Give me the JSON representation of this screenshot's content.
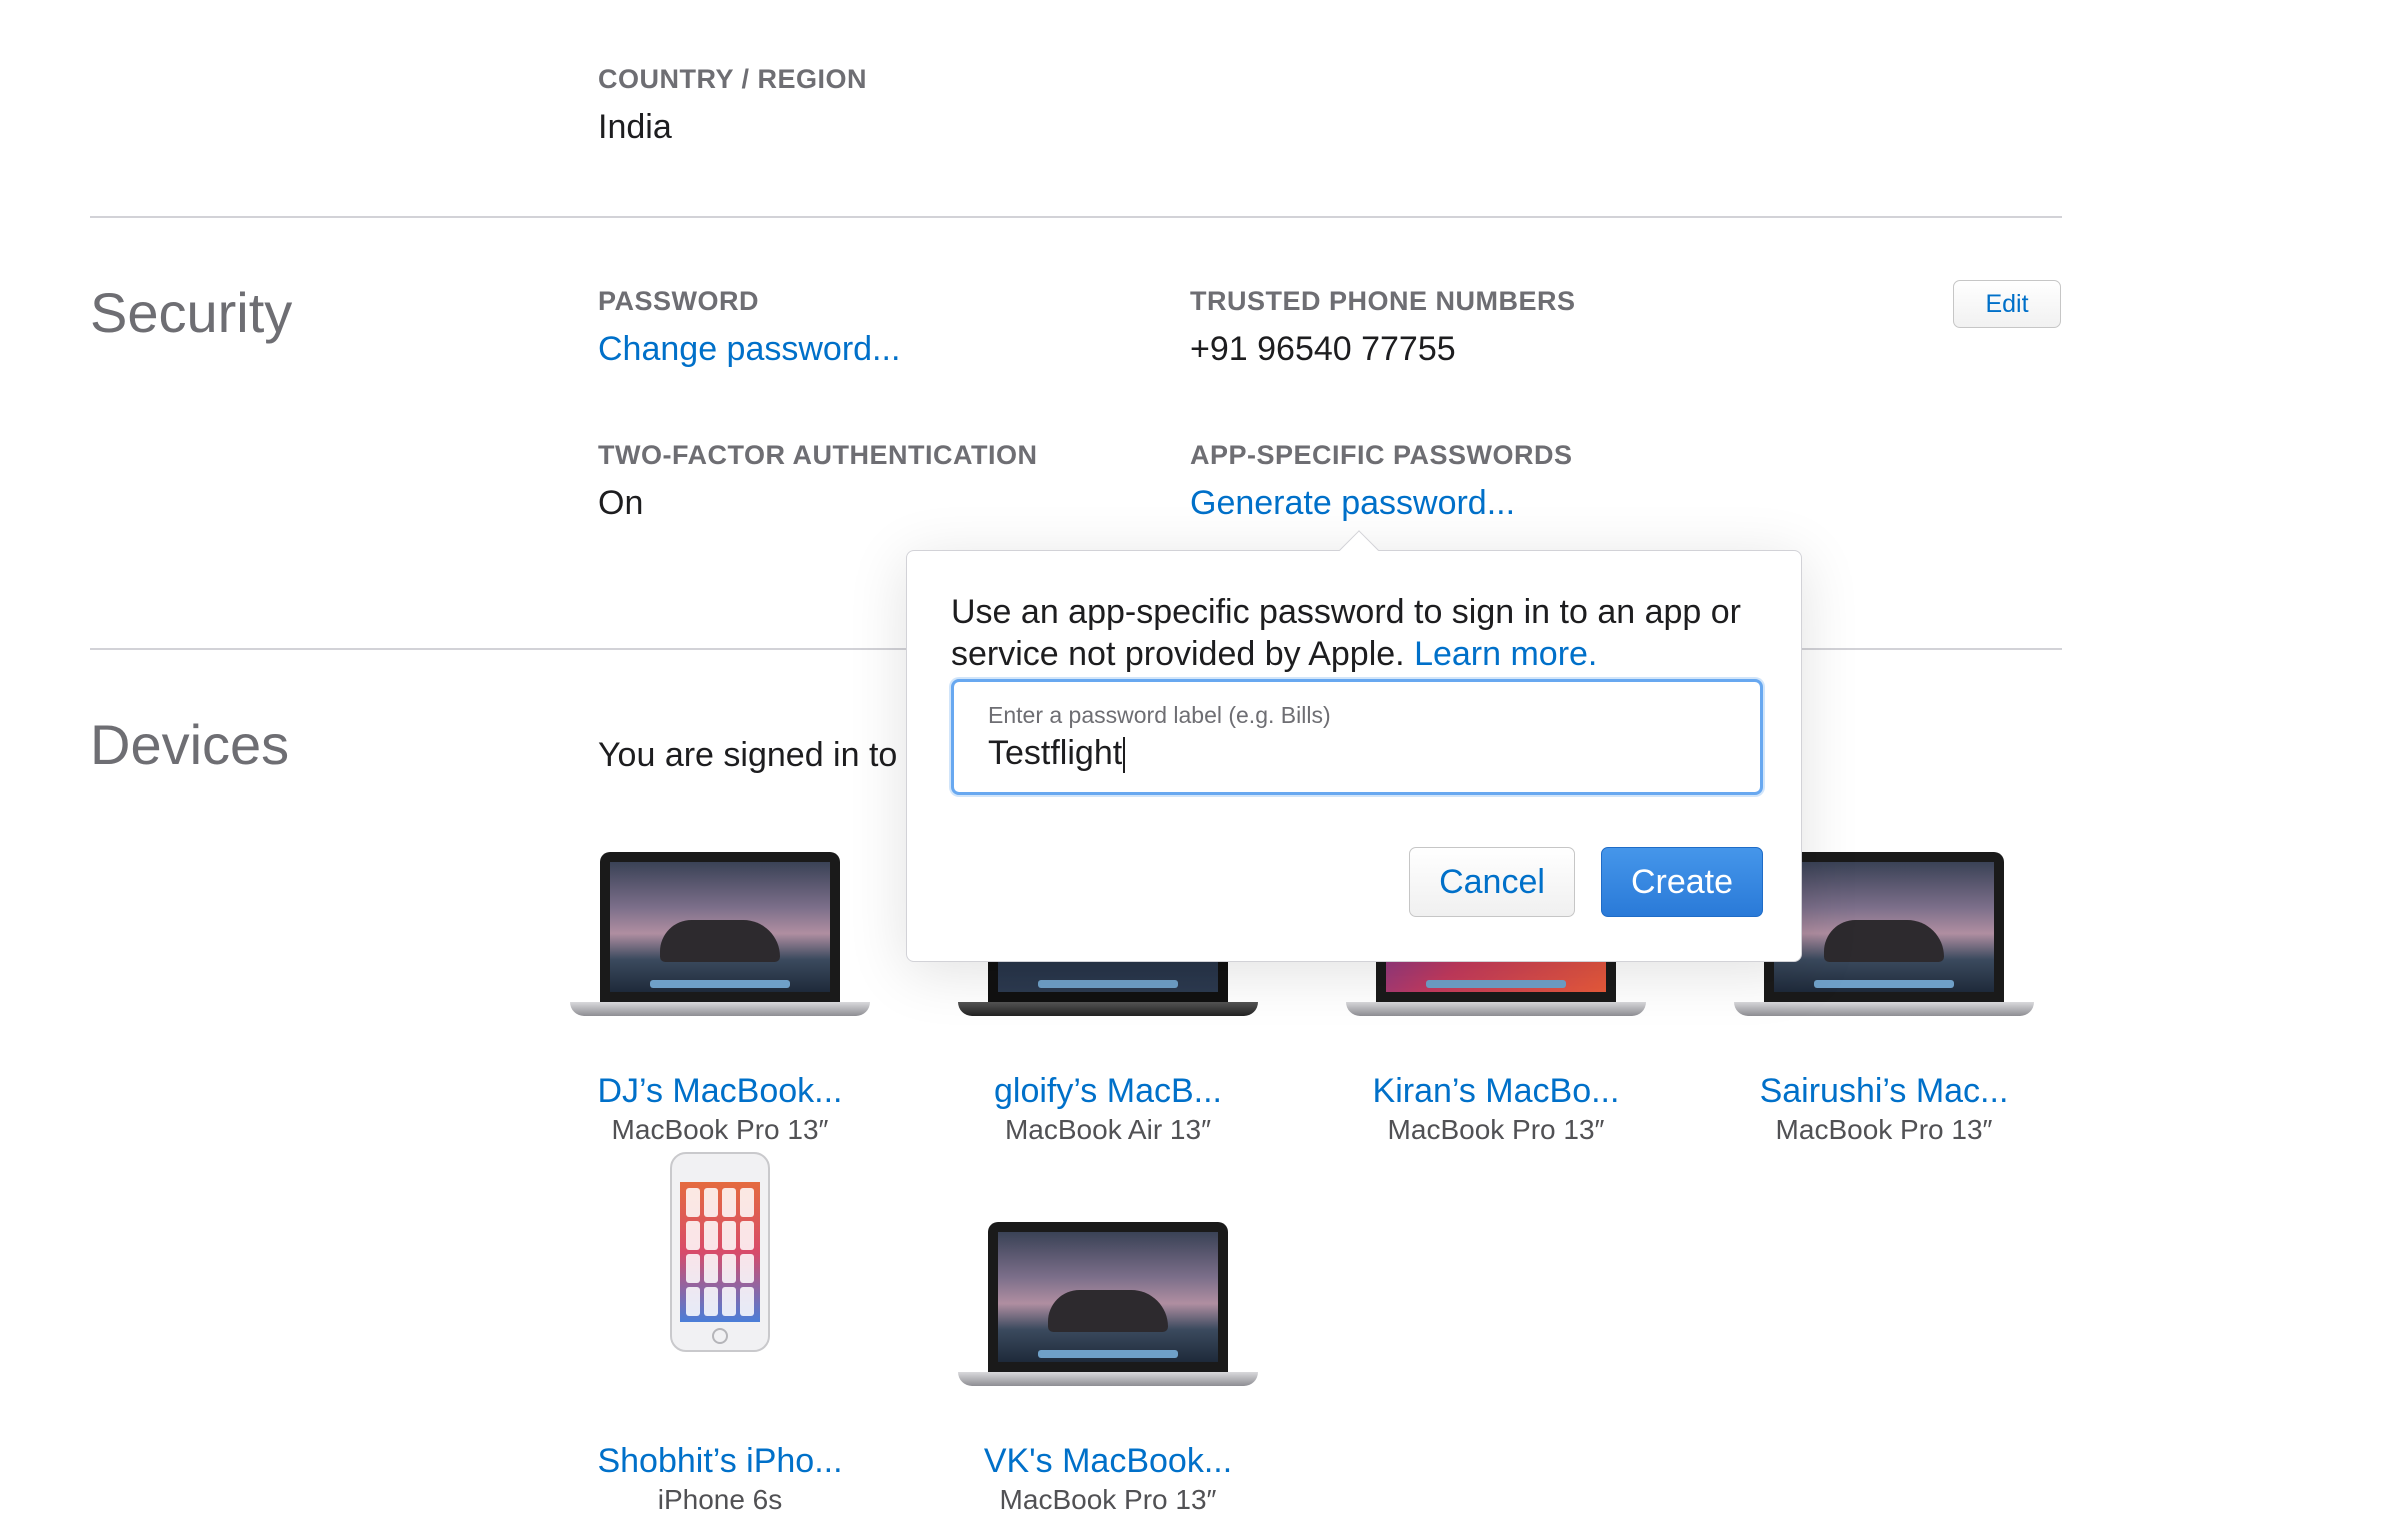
{
  "country": {
    "label": "COUNTRY / REGION",
    "value": "India"
  },
  "security": {
    "title": "Security",
    "password_label": "PASSWORD",
    "change_password_link": "Change password...",
    "trusted_label": "TRUSTED PHONE NUMBERS",
    "trusted_value": "+91 96540 77755",
    "edit_button": "Edit",
    "two_factor_label": "TWO-FACTOR AUTHENTICATION",
    "two_factor_value": "On",
    "app_specific_label": "APP-SPECIFIC PASSWORDS",
    "generate_link": "Generate password..."
  },
  "devices": {
    "title": "Devices",
    "intro": "You are signed in to t",
    "items": [
      {
        "name": "DJ’s MacBook...",
        "model": "MacBook Pro 13″",
        "icon": "laptop-icon"
      },
      {
        "name": "gloify’s MacB...",
        "model": "MacBook Air 13″",
        "icon": "laptop-icon"
      },
      {
        "name": "Kiran’s MacBo...",
        "model": "MacBook Pro 13″",
        "icon": "laptop-icon"
      },
      {
        "name": "Sairushi’s Mac...",
        "model": "MacBook Pro 13″",
        "icon": "laptop-icon"
      },
      {
        "name": "Shobhit’s iPho...",
        "model": "iPhone 6s",
        "icon": "phone-icon"
      },
      {
        "name": "VK's MacBook...",
        "model": "MacBook Pro 13″",
        "icon": "laptop-icon"
      }
    ]
  },
  "popover": {
    "message": "Use an app-specific password to sign in to an app or service not provided by Apple.",
    "learn_more": "Learn more.",
    "field_placeholder": "Enter a password label (e.g. Bills)",
    "field_value": "Testflight",
    "cancel_label": "Cancel",
    "create_label": "Create"
  }
}
